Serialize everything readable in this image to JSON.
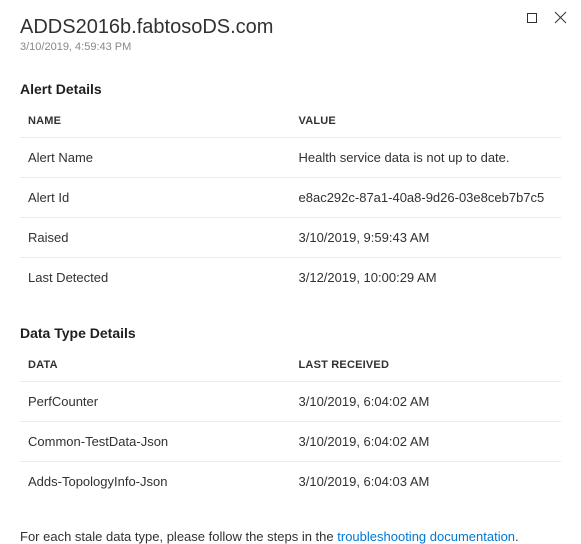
{
  "header": {
    "title": "ADDS2016b.fabtosoDS.com",
    "timestamp": "3/10/2019, 4:59:43 PM"
  },
  "alert_details": {
    "section_title": "Alert Details",
    "columns": {
      "name": "NAME",
      "value": "VALUE"
    },
    "rows": [
      {
        "name": "Alert Name",
        "value": "Health service data is not up to date."
      },
      {
        "name": "Alert Id",
        "value": "e8ac292c-87a1-40a8-9d26-03e8ceb7b7c5"
      },
      {
        "name": "Raised",
        "value": "3/10/2019, 9:59:43 AM"
      },
      {
        "name": "Last Detected",
        "value": "3/12/2019, 10:00:29 AM"
      }
    ]
  },
  "data_type_details": {
    "section_title": "Data Type Details",
    "columns": {
      "data": "DATA",
      "last_received": "LAST RECEIVED"
    },
    "rows": [
      {
        "data": "PerfCounter",
        "last_received": "3/10/2019, 6:04:02 AM"
      },
      {
        "data": "Common-TestData-Json",
        "last_received": "3/10/2019, 6:04:02 AM"
      },
      {
        "data": "Adds-TopologyInfo-Json",
        "last_received": "3/10/2019, 6:04:03 AM"
      }
    ]
  },
  "footnote": {
    "prefix": "For each stale data type, please follow the steps in the ",
    "link_text": "troubleshooting documentation",
    "suffix": "."
  }
}
